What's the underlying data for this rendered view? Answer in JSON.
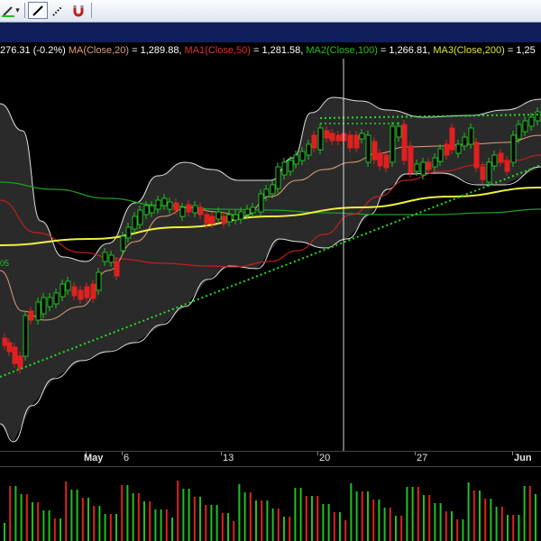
{
  "toolbar": {
    "buttons": [
      {
        "name": "line-color-dropdown",
        "icon": "pen-color-icon",
        "label": "▾"
      },
      {
        "name": "draw-line-button",
        "icon": "line-tool-icon"
      },
      {
        "name": "dotted-line-button",
        "icon": "dotted-line-icon"
      },
      {
        "name": "magnet-button",
        "icon": "magnet-icon"
      }
    ]
  },
  "legend": [
    {
      "text": "276.31 (-0.2%) ",
      "color": "#ffffff"
    },
    {
      "text": "MA(Close,20)",
      "color": "#e0a07a"
    },
    {
      "text": " = 1,289.88, ",
      "color": "#ffffff"
    },
    {
      "text": "MA1(Close,50)",
      "color": "#e03030"
    },
    {
      "text": " = 1,281.58, ",
      "color": "#ffffff"
    },
    {
      "text": "MA2(Close,100)",
      "color": "#20c020"
    },
    {
      "text": " = 1,266.81, ",
      "color": "#ffffff"
    },
    {
      "text": "MA3(Close,200)",
      "color": "#e0e040"
    },
    {
      "text": " = 1,25",
      "color": "#ffffff"
    }
  ],
  "xaxis": {
    "labels": [
      {
        "text": "May",
        "bold": true
      },
      {
        "text": "6",
        "bold": false
      },
      {
        "text": "13",
        "bold": false
      },
      {
        "text": "20",
        "bold": false
      },
      {
        "text": "27",
        "bold": false
      },
      {
        "text": "Jun",
        "bold": true
      }
    ]
  },
  "left_edge_label": "05",
  "colors": {
    "up": "#20c020",
    "down": "#e02020",
    "ma20": "#e0a07a",
    "ma50": "#c02020",
    "ma100": "#20a020",
    "ma200": "#f0f040",
    "bands": "#e0e0e0",
    "trendline": "#20e020",
    "resistance": "#20e020",
    "crosshair": "#ffffff"
  },
  "chart_data": {
    "type": "candlestick",
    "title": "",
    "xlabel": "",
    "ylabel": "",
    "series": [
      {
        "name": "MA(Close,20)",
        "last": 1289.88
      },
      {
        "name": "MA1(Close,50)",
        "last": 1281.58
      },
      {
        "name": "MA2(Close,100)",
        "last": 1266.81
      },
      {
        "name": "MA3(Close,200)",
        "last": "1,25"
      }
    ],
    "last_close": "276.31",
    "last_change_pct": -0.2,
    "x_labels": [
      "May",
      "6",
      "13",
      "20",
      "27",
      "Jun"
    ],
    "legend_placement": "top",
    "grid": false
  }
}
